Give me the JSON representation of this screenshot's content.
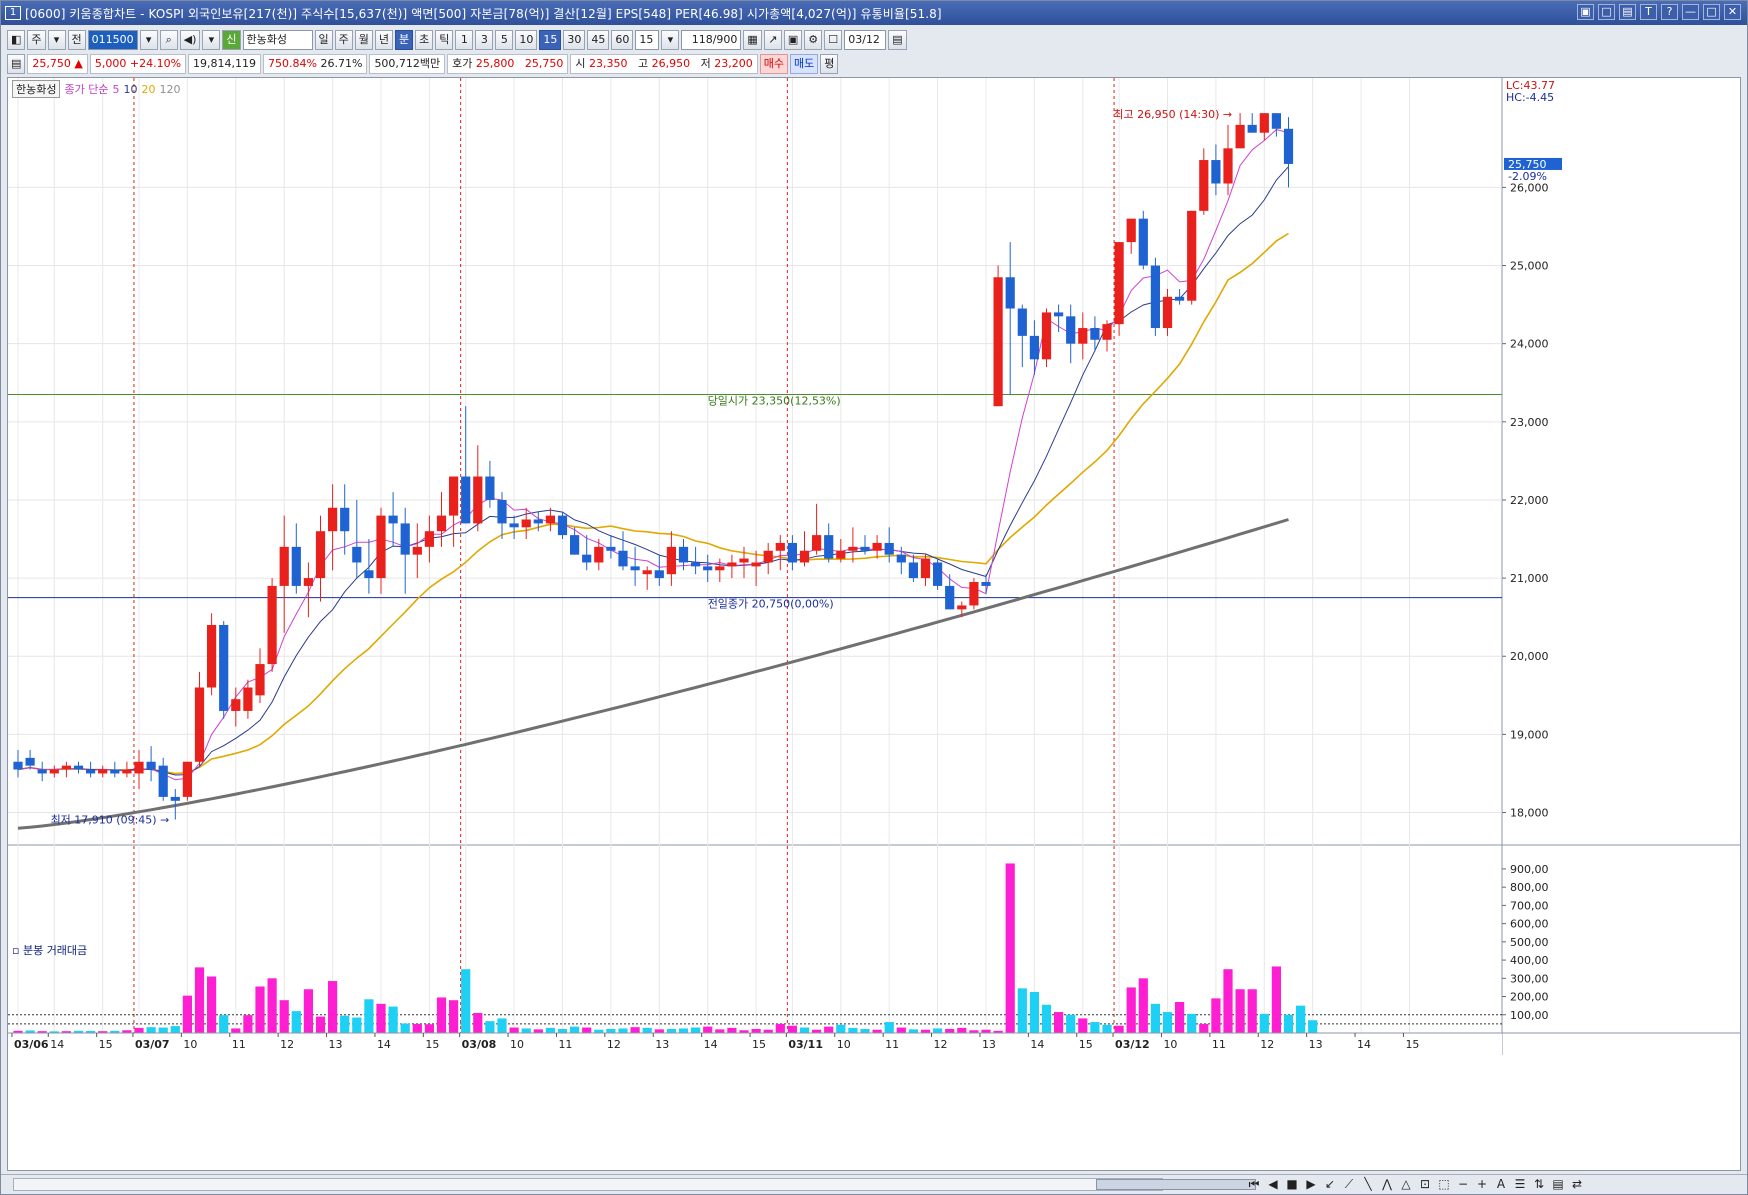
{
  "titlebar": {
    "num": "1",
    "title": "[0600] 키움종합차트 - KOSPI 외국인보유[217(천)] 주식수[15,637(천)] 액면[500] 자본금[78(억)] 결산[12월] EPS[548] PER[46.98] 시가총액[4,027(억)] 유통비율[51.8]",
    "controls": [
      "▣",
      "□",
      "▤",
      "T",
      "?",
      "—",
      "□",
      "✕"
    ]
  },
  "toolbar1": {
    "kind1": "주",
    "kind2": "전",
    "code": "011500",
    "stock_name": "한농화성",
    "periods": [
      "일",
      "주",
      "월",
      "년",
      "분",
      "초",
      "틱"
    ],
    "period_selected": "분",
    "intervals": [
      "1",
      "3",
      "5",
      "10",
      "15",
      "30",
      "45",
      "60"
    ],
    "interval_selected": "15",
    "interval_value": "15",
    "count": "118/900",
    "date": "03/12"
  },
  "toolbar2": {
    "price": "25,750",
    "change": "5,000",
    "change_pct": "+24.10%",
    "volume": "19,814,119",
    "vol_ratio": "750.84%",
    "turnover": "26.71%",
    "amount": "500,712백만",
    "hoga_label": "호가",
    "ask": "25,800",
    "bid": "25,750",
    "open_label": "시",
    "open": "23,350",
    "high_label": "고",
    "high": "26,950",
    "low_label": "저",
    "low": "23,200",
    "buy_label": "매수",
    "sell_label": "매도",
    "eval_label": "평"
  },
  "legend": {
    "name": "한농화성",
    "indicator": "종가 단순",
    "ma": [
      "5",
      "10",
      "20",
      "120"
    ]
  },
  "annotations": {
    "high_marker": "최고 26,950 (14:30) →",
    "low_marker": "최저 17,910 (09:45) →",
    "open_line": "당일시가 23,350(12,53%)",
    "prev_close_line": "전일종가 20,750(0,00%)",
    "lc": "LC:43.77",
    "hc": "HC:-4.45",
    "price_tag": "25,750",
    "price_tag_pct": "-2.09%"
  },
  "volume_panel": {
    "title": "분봉 거래대금"
  },
  "colors": {
    "up": "#e8211c",
    "down": "#1f63d2",
    "ma5": "#d040d0",
    "ma10": "#2c3a8c",
    "ma20": "#e0a800",
    "ma120": "#707070",
    "vol_up": "#ff1fd2",
    "vol_down": "#1fd0f5"
  },
  "chart_data": [
    {
      "type": "candlestick",
      "title": "",
      "y_ticks": [
        "26,000",
        "25,000",
        "24,000",
        "23,000",
        "22,000",
        "21,000",
        "20,000",
        "19,000",
        "18,000"
      ],
      "y_tick_values": [
        26000,
        25000,
        24000,
        23000,
        22000,
        21000,
        20000,
        19000,
        18000
      ],
      "ylim": [
        17610,
        27400
      ],
      "x_labels": [
        "03/06",
        "14",
        "15",
        "03/07",
        "10",
        "11",
        "12",
        "13",
        "14",
        "15",
        "03/08",
        "10",
        "11",
        "12",
        "13",
        "14",
        "15",
        "03/11",
        "10",
        "11",
        "12",
        "13",
        "14",
        "15",
        "03/12",
        "10",
        "11",
        "12",
        "13",
        "14",
        "15"
      ],
      "x_label_bars": [
        0,
        3,
        7,
        10,
        14,
        18,
        22,
        26,
        30,
        34,
        37,
        41,
        45,
        49,
        53,
        57,
        61,
        64,
        68,
        72,
        76,
        80,
        84,
        88,
        91,
        95,
        99,
        103,
        107,
        111,
        115
      ],
      "session_breaks": [
        10,
        37,
        64,
        91
      ],
      "reference_lines": [
        {
          "label": "당일시가",
          "value": 23350
        },
        {
          "label": "전일종가",
          "value": 20750
        }
      ],
      "ohlc": [
        [
          18650,
          18800,
          18450,
          18550
        ],
        [
          18700,
          18800,
          18550,
          18600
        ],
        [
          18550,
          18650,
          18400,
          18500
        ],
        [
          18500,
          18600,
          18450,
          18550
        ],
        [
          18550,
          18650,
          18450,
          18600
        ],
        [
          18600,
          18650,
          18500,
          18550
        ],
        [
          18550,
          18650,
          18450,
          18500
        ],
        [
          18500,
          18600,
          18450,
          18550
        ],
        [
          18550,
          18650,
          18450,
          18500
        ],
        [
          18500,
          18650,
          18450,
          18550
        ],
        [
          18500,
          18800,
          18300,
          18650
        ],
        [
          18650,
          18850,
          18400,
          18550
        ],
        [
          18600,
          18700,
          18150,
          18200
        ],
        [
          18200,
          18300,
          17910,
          18150
        ],
        [
          18200,
          18650,
          18150,
          18650
        ],
        [
          18650,
          19800,
          18600,
          19600
        ],
        [
          19600,
          20550,
          19500,
          20400
        ],
        [
          20400,
          20450,
          19200,
          19300
        ],
        [
          19300,
          19600,
          19100,
          19450
        ],
        [
          19300,
          19700,
          19200,
          19600
        ],
        [
          19500,
          20100,
          19400,
          19900
        ],
        [
          19900,
          21000,
          19800,
          20900
        ],
        [
          20900,
          21800,
          20300,
          21400
        ],
        [
          21400,
          21700,
          20800,
          20900
        ],
        [
          20900,
          21200,
          20500,
          21000
        ],
        [
          21000,
          21800,
          20700,
          21600
        ],
        [
          21600,
          22200,
          21100,
          21900
        ],
        [
          21900,
          22200,
          21300,
          21600
        ],
        [
          21400,
          22000,
          21000,
          21200
        ],
        [
          21100,
          21500,
          20800,
          21000
        ],
        [
          21000,
          21900,
          20800,
          21800
        ],
        [
          21800,
          22100,
          21400,
          21700
        ],
        [
          21700,
          21900,
          20800,
          21300
        ],
        [
          21300,
          21700,
          21000,
          21400
        ],
        [
          21400,
          21800,
          21200,
          21600
        ],
        [
          21600,
          22100,
          21400,
          21800
        ],
        [
          21800,
          22300,
          21400,
          22300
        ],
        [
          22300,
          23200,
          21800,
          21700
        ],
        [
          21700,
          22700,
          21600,
          22300
        ],
        [
          22300,
          22500,
          21900,
          22000
        ],
        [
          22000,
          22100,
          21500,
          21700
        ],
        [
          21700,
          21800,
          21500,
          21650
        ],
        [
          21650,
          21900,
          21500,
          21750
        ],
        [
          21750,
          21850,
          21600,
          21700
        ],
        [
          21700,
          21900,
          21600,
          21800
        ],
        [
          21800,
          21850,
          21500,
          21550
        ],
        [
          21550,
          21650,
          21300,
          21300
        ],
        [
          21300,
          21550,
          21100,
          21200
        ],
        [
          21200,
          21500,
          21100,
          21400
        ],
        [
          21400,
          21550,
          21250,
          21350
        ],
        [
          21350,
          21600,
          21100,
          21150
        ],
        [
          21150,
          21400,
          20900,
          21100
        ],
        [
          21050,
          21150,
          20850,
          21100
        ],
        [
          21100,
          21300,
          20900,
          21000
        ],
        [
          21050,
          21600,
          20900,
          21400
        ],
        [
          21400,
          21500,
          21100,
          21200
        ],
        [
          21200,
          21400,
          21050,
          21150
        ],
        [
          21150,
          21300,
          20950,
          21100
        ],
        [
          21100,
          21250,
          20950,
          21150
        ],
        [
          21150,
          21300,
          21000,
          21200
        ],
        [
          21200,
          21400,
          21000,
          21250
        ],
        [
          21150,
          21350,
          20900,
          21200
        ],
        [
          21200,
          21450,
          21050,
          21350
        ],
        [
          21350,
          21550,
          21100,
          21450
        ],
        [
          21450,
          21550,
          21100,
          21200
        ],
        [
          21200,
          21600,
          21150,
          21350
        ],
        [
          21350,
          21950,
          21300,
          21550
        ],
        [
          21550,
          21700,
          21200,
          21250
        ],
        [
          21250,
          21500,
          21200,
          21350
        ],
        [
          21350,
          21650,
          21200,
          21400
        ],
        [
          21400,
          21550,
          21300,
          21350
        ],
        [
          21350,
          21550,
          21250,
          21450
        ],
        [
          21450,
          21650,
          21200,
          21300
        ],
        [
          21300,
          21400,
          21050,
          21200
        ],
        [
          21200,
          21300,
          20950,
          21000
        ],
        [
          21000,
          21300,
          20900,
          21250
        ],
        [
          21200,
          21250,
          20850,
          20900
        ],
        [
          20900,
          21050,
          20600,
          20600
        ],
        [
          20600,
          20700,
          20500,
          20650
        ],
        [
          20650,
          21000,
          20600,
          20950
        ],
        [
          20950,
          21050,
          20800,
          20900
        ],
        [
          23200,
          25000,
          23200,
          24850
        ],
        [
          24850,
          25300,
          23350,
          24450
        ],
        [
          24450,
          24500,
          23700,
          24100
        ],
        [
          24100,
          24300,
          23600,
          23800
        ],
        [
          23800,
          24450,
          23700,
          24400
        ],
        [
          24400,
          24500,
          24150,
          24350
        ],
        [
          24350,
          24500,
          23750,
          24000
        ],
        [
          24000,
          24400,
          23800,
          24200
        ],
        [
          24200,
          24350,
          23900,
          24050
        ],
        [
          24050,
          24300,
          23900,
          24250
        ],
        [
          24250,
          25300,
          24100,
          25300
        ],
        [
          25300,
          25600,
          25150,
          25600
        ],
        [
          25600,
          25700,
          24950,
          25000
        ],
        [
          25000,
          25100,
          24100,
          24200
        ],
        [
          24200,
          24700,
          24100,
          24600
        ],
        [
          24600,
          24700,
          24500,
          24550
        ],
        [
          24550,
          25700,
          24500,
          25700
        ],
        [
          25700,
          26500,
          25650,
          26350
        ],
        [
          26350,
          26550,
          25900,
          26050
        ],
        [
          26050,
          26800,
          25900,
          26500
        ],
        [
          26500,
          26950,
          26500,
          26800
        ],
        [
          26800,
          26950,
          26700,
          26700
        ],
        [
          26700,
          26950,
          26600,
          26950
        ],
        [
          26950,
          26950,
          26650,
          26750
        ],
        [
          26750,
          26900,
          26000,
          26300
        ]
      ],
      "ma5_last": 26500,
      "ma10_last": 26350,
      "ma20_last": 25500,
      "ma120_last": 21750
    },
    {
      "type": "bar",
      "title": "분봉 거래대금",
      "y_ticks": [
        "900,00",
        "800,00",
        "700,00",
        "600,00",
        "500,00",
        "400,00",
        "300,00",
        "200,00",
        "100,00"
      ],
      "y_tick_values": [
        900,
        800,
        700,
        600,
        500,
        400,
        300,
        200,
        100
      ],
      "ylim": [
        0,
        960
      ],
      "values": [
        12,
        14,
        10,
        9,
        10,
        12,
        11,
        10,
        12,
        15,
        28,
        32,
        30,
        38,
        205,
        360,
        310,
        98,
        25,
        98,
        255,
        300,
        180,
        120,
        240,
        90,
        285,
        95,
        85,
        185,
        160,
        145,
        52,
        50,
        48,
        195,
        180,
        350,
        110,
        65,
        80,
        30,
        25,
        20,
        28,
        22,
        35,
        30,
        18,
        22,
        25,
        32,
        28,
        20,
        22,
        25,
        30,
        35,
        20,
        28,
        15,
        22,
        18,
        50,
        40,
        30,
        18,
        35,
        45,
        28,
        22,
        18,
        60,
        30,
        20,
        18,
        25,
        22,
        28,
        15,
        18,
        12,
        930,
        245,
        225,
        155,
        115,
        100,
        80,
        60,
        45,
        40,
        250,
        300,
        160,
        115,
        170,
        105,
        50,
        190,
        350,
        240,
        240,
        105,
        365,
        100,
        150,
        70
      ],
      "up": [
        1,
        0,
        1,
        0,
        1,
        0,
        0,
        1,
        0,
        1,
        1,
        0,
        0,
        0,
        1,
        1,
        1,
        0,
        1,
        1,
        1,
        1,
        1,
        0,
        1,
        1,
        1,
        0,
        0,
        0,
        1,
        0,
        0,
        1,
        1,
        1,
        1,
        0,
        1,
        0,
        0,
        1,
        0,
        1,
        0,
        0,
        0,
        1,
        0,
        0,
        0,
        1,
        0,
        1,
        0,
        0,
        0,
        1,
        1,
        1,
        1,
        1,
        1,
        1,
        1,
        0,
        1,
        1,
        0,
        0,
        0,
        1,
        0,
        1,
        0,
        1,
        0,
        1,
        1,
        1,
        1,
        1,
        1,
        0,
        0,
        0,
        1,
        0,
        1,
        0,
        0,
        1,
        1,
        1,
        0,
        0,
        1,
        0,
        1,
        1,
        1,
        1,
        1,
        0,
        1,
        0,
        0,
        0
      ]
    }
  ]
}
